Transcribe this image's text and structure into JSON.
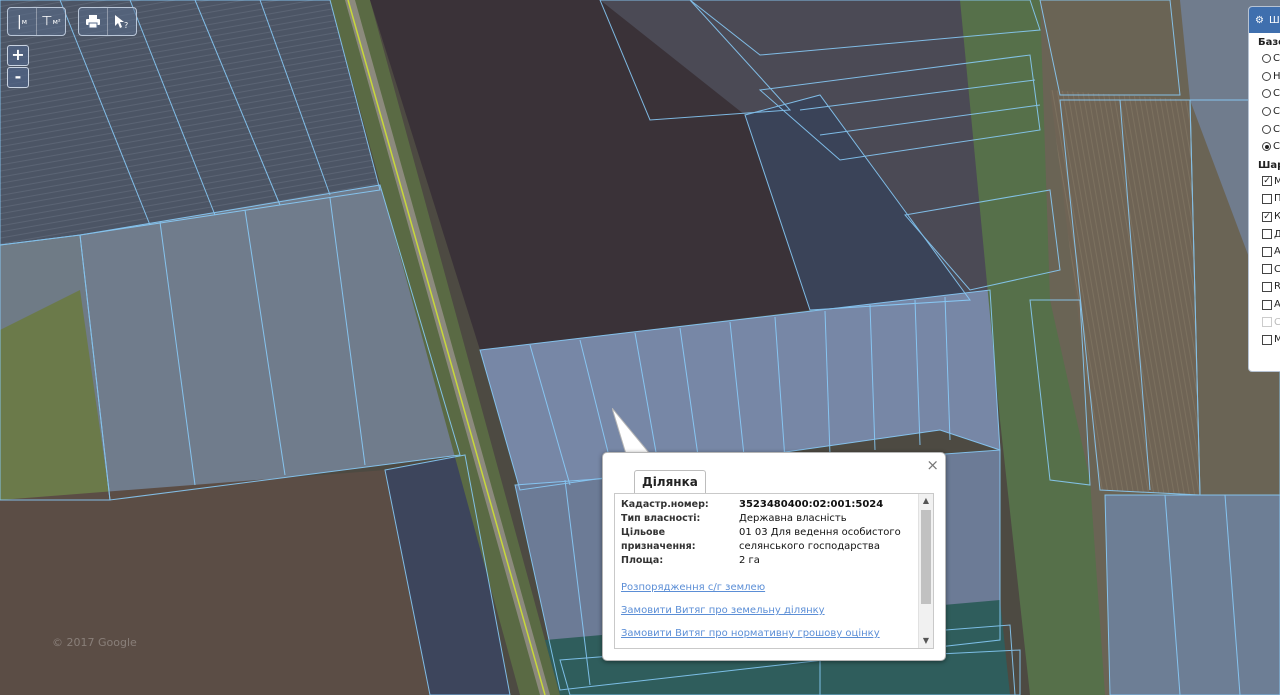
{
  "map": {
    "watermark": "© 2017 Google"
  },
  "toolbar": {
    "ruler_label": "м",
    "area_label": "м²",
    "print_icon": "print-icon",
    "info_icon": "info-cursor-icon"
  },
  "zoom": {
    "in": "+",
    "out": "-"
  },
  "panel": {
    "header_text": "Ш",
    "base_section": "Базо",
    "base_options": [
      {
        "label": "С",
        "selected": false
      },
      {
        "label": "Н",
        "selected": false
      },
      {
        "label": "С",
        "selected": false
      },
      {
        "label": "С",
        "selected": false
      },
      {
        "label": "С",
        "selected": false
      },
      {
        "label": "С",
        "selected": true
      }
    ],
    "layers_section": "Шар",
    "layers": [
      {
        "label": "М",
        "checked": true,
        "disabled": false
      },
      {
        "label": "П",
        "checked": false,
        "disabled": false
      },
      {
        "label": "К",
        "checked": true,
        "disabled": false
      },
      {
        "label": "Д",
        "checked": false,
        "disabled": false
      },
      {
        "label": "А",
        "checked": false,
        "disabled": false
      },
      {
        "label": "С",
        "checked": false,
        "disabled": false
      },
      {
        "label": "R",
        "checked": false,
        "disabled": false
      },
      {
        "label": "А",
        "checked": false,
        "disabled": false
      },
      {
        "label": "С",
        "checked": false,
        "disabled": true
      },
      {
        "label": "М",
        "checked": false,
        "disabled": false
      }
    ]
  },
  "popup": {
    "tab_label": "Ділянка",
    "close": "×",
    "fields": [
      {
        "key": "Кадастр.номер:",
        "value": "3523480400:02:001:5024",
        "bold": true
      },
      {
        "key": "Тип власності:",
        "value": "Державна власність",
        "bold": false
      },
      {
        "key": "Цільове призначення:",
        "value": "01 03 Для ведення особистого селянського господарства",
        "bold": false
      },
      {
        "key": "Площа:",
        "value": "2 га",
        "bold": false
      }
    ],
    "links": [
      "Розпорядження с/г землею",
      "Замовити Витяг про земельну ділянку",
      "Замовити Витяг про нормативну грошову оцінку"
    ]
  }
}
